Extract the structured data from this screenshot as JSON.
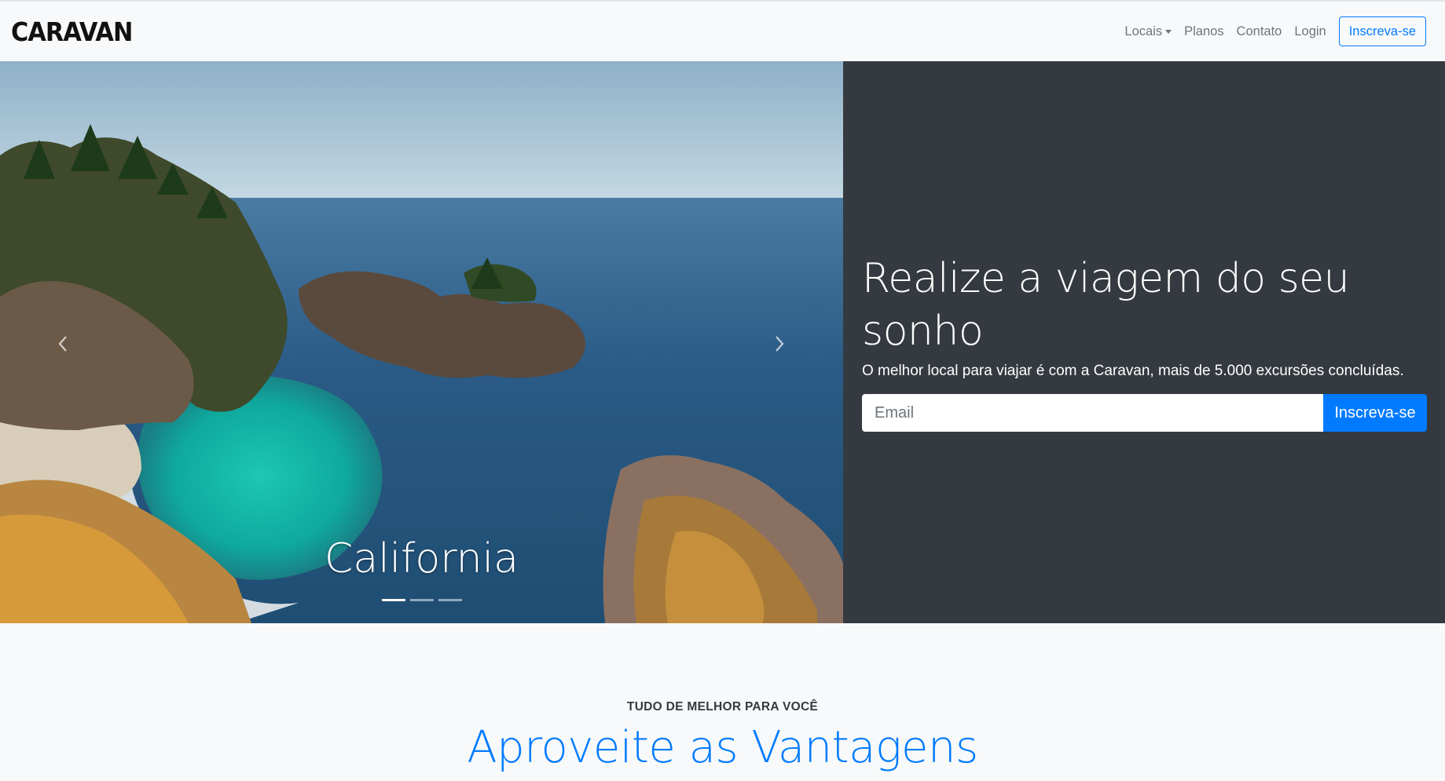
{
  "nav": {
    "brand": "CARAVAN",
    "links": [
      {
        "label": "Locais",
        "dropdown": true
      },
      {
        "label": "Planos"
      },
      {
        "label": "Contato"
      },
      {
        "label": "Login"
      }
    ],
    "cta": "Inscreva-se"
  },
  "carousel": {
    "caption": "California",
    "prev_icon": "chevron-left-icon",
    "next_icon": "chevron-right-icon",
    "slides": 3,
    "active_slide": 1
  },
  "hero": {
    "headline": "Realize a viagem do seu sonho",
    "subtext": "O melhor local para viajar é com a Caravan, mais de 5.000 excursões concluídas.",
    "email_placeholder": "Email",
    "submit_label": "Inscreva-se"
  },
  "benefits": {
    "eyebrow": "TUDO DE MELHOR PARA VOCÊ",
    "title": "Aproveite as Vantagens"
  },
  "colors": {
    "primary": "#007bff",
    "dark": "#343a40",
    "light": "#f8f9fa",
    "muted": "#6c757d"
  }
}
